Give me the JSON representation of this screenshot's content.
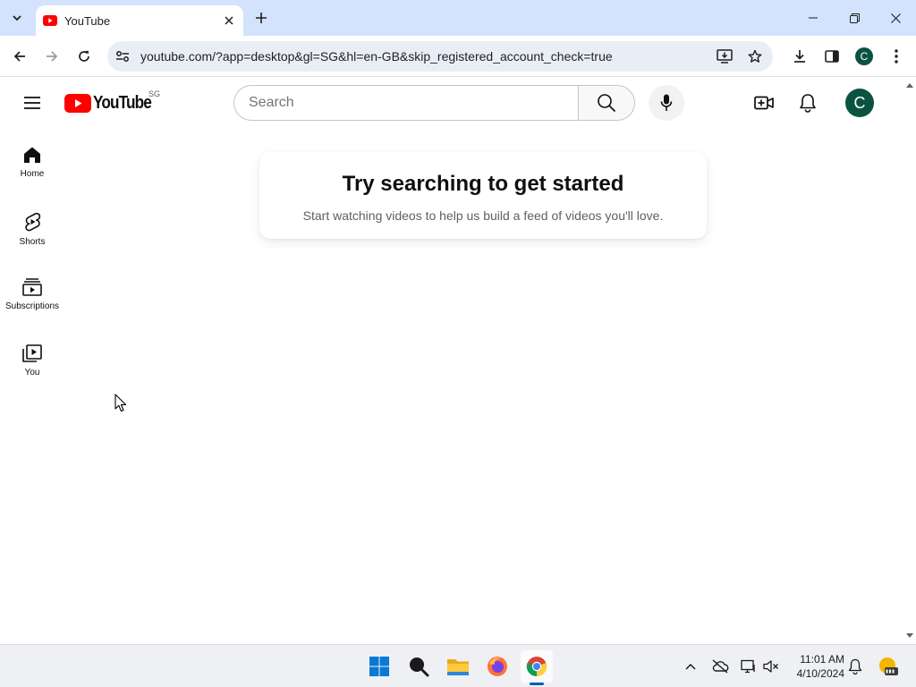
{
  "browser": {
    "tab_title": "YouTube",
    "url": "youtube.com/?app=desktop&gl=SG&hl=en-GB&skip_registered_account_check=true",
    "profile_initial": "C"
  },
  "youtube": {
    "logo_text": "YouTube",
    "country_code": "SG",
    "search_placeholder": "Search",
    "avatar_initial": "C",
    "guide": [
      {
        "label": "Home",
        "icon": "home-icon"
      },
      {
        "label": "Shorts",
        "icon": "shorts-icon"
      },
      {
        "label": "Subscriptions",
        "icon": "subscriptions-icon"
      },
      {
        "label": "You",
        "icon": "you-icon"
      }
    ],
    "empty_state": {
      "title": "Try searching to get started",
      "subtitle": "Start watching videos to help us build a feed of videos you'll love."
    }
  },
  "taskbar": {
    "time": "11:01 AM",
    "date": "4/10/2024"
  },
  "colors": {
    "youtube_red": "#ff0000",
    "avatar_bg": "#0b5340",
    "tabstrip_bg": "#d3e3fd"
  }
}
